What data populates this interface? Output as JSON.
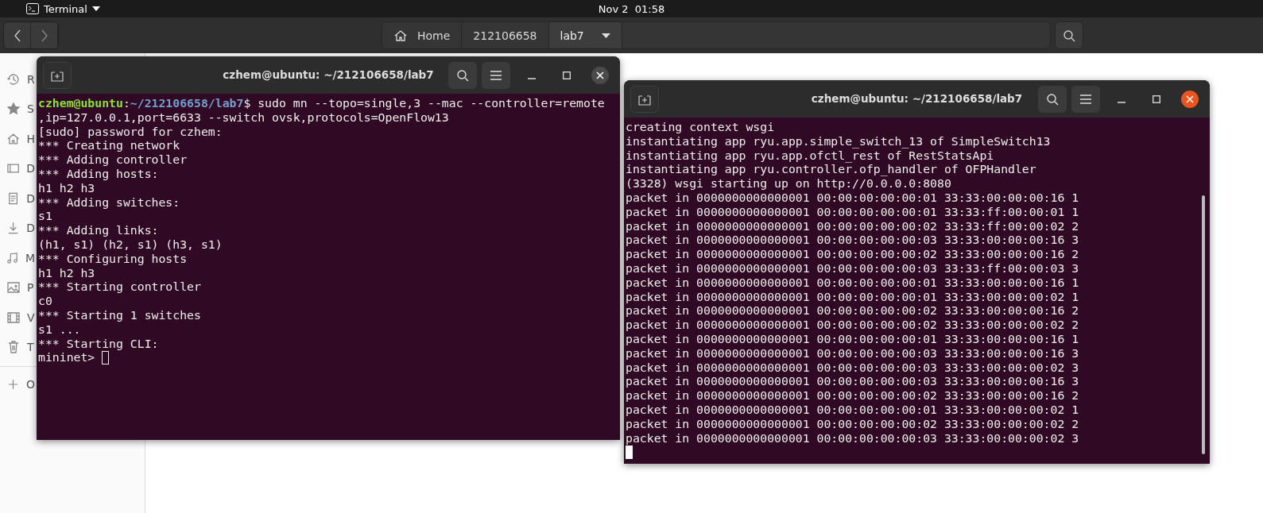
{
  "top_bar": {
    "app_menu": "Terminal",
    "clock": "Nov 2  01:58"
  },
  "file_manager": {
    "breadcrumbs": [
      {
        "label": "Home",
        "selected": false
      },
      {
        "label": "212106658",
        "selected": false
      },
      {
        "label": "lab7",
        "selected": true
      }
    ],
    "sidebar": {
      "items": [
        {
          "label": "R"
        },
        {
          "label": "S"
        },
        {
          "label": "H"
        },
        {
          "label": "D"
        },
        {
          "label": "D"
        },
        {
          "label": "D"
        },
        {
          "label": "M"
        },
        {
          "label": "P"
        },
        {
          "label": "V"
        },
        {
          "label": "T"
        },
        {
          "label": "O"
        }
      ]
    }
  },
  "terminals": [
    {
      "title": "czhem@ubuntu: ~/212106658/lab7",
      "focused": false,
      "prompt": {
        "user": "czhem@ubuntu",
        "separator": ":",
        "path": "~/212106658/lab7",
        "command": "$ sudo mn --topo=single,3 --mac --controller=remote"
      },
      "lines": [
        ",ip=127.0.0.1,port=6633 --switch ovsk,protocols=OpenFlow13",
        "[sudo] password for czhem:",
        "*** Creating network",
        "*** Adding controller",
        "*** Adding hosts:",
        "h1 h2 h3",
        "*** Adding switches:",
        "s1",
        "*** Adding links:",
        "(h1, s1) (h2, s1) (h3, s1)",
        "*** Configuring hosts",
        "h1 h2 h3",
        "*** Starting controller",
        "c0",
        "*** Starting 1 switches",
        "s1 ...",
        "*** Starting CLI:"
      ],
      "input": "mininet> "
    },
    {
      "title": "czhem@ubuntu: ~/212106658/lab7",
      "focused": true,
      "lines": [
        "creating context wsgi",
        "instantiating app ryu.app.simple_switch_13 of SimpleSwitch13",
        "instantiating app ryu.app.ofctl_rest of RestStatsApi",
        "instantiating app ryu.controller.ofp_handler of OFPHandler",
        "(3328) wsgi starting up on http://0.0.0.0:8080",
        "packet in 0000000000000001 00:00:00:00:00:01 33:33:00:00:00:16 1",
        "packet in 0000000000000001 00:00:00:00:00:01 33:33:ff:00:00:01 1",
        "packet in 0000000000000001 00:00:00:00:00:02 33:33:ff:00:00:02 2",
        "packet in 0000000000000001 00:00:00:00:00:03 33:33:00:00:00:16 3",
        "packet in 0000000000000001 00:00:00:00:00:02 33:33:00:00:00:16 2",
        "packet in 0000000000000001 00:00:00:00:00:03 33:33:ff:00:00:03 3",
        "packet in 0000000000000001 00:00:00:00:00:01 33:33:00:00:00:16 1",
        "packet in 0000000000000001 00:00:00:00:00:01 33:33:00:00:00:02 1",
        "packet in 0000000000000001 00:00:00:00:00:02 33:33:00:00:00:16 2",
        "packet in 0000000000000001 00:00:00:00:00:02 33:33:00:00:00:02 2",
        "packet in 0000000000000001 00:00:00:00:00:01 33:33:00:00:00:16 1",
        "packet in 0000000000000001 00:00:00:00:00:03 33:33:00:00:00:16 3",
        "packet in 0000000000000001 00:00:00:00:00:03 33:33:00:00:00:02 3",
        "packet in 0000000000000001 00:00:00:00:00:03 33:33:00:00:00:16 3",
        "packet in 0000000000000001 00:00:00:00:00:02 33:33:00:00:00:16 2",
        "packet in 0000000000000001 00:00:00:00:00:01 33:33:00:00:00:02 1",
        "packet in 0000000000000001 00:00:00:00:00:02 33:33:00:00:00:02 2",
        "packet in 0000000000000001 00:00:00:00:00:03 33:33:00:00:00:02 3"
      ]
    }
  ]
}
